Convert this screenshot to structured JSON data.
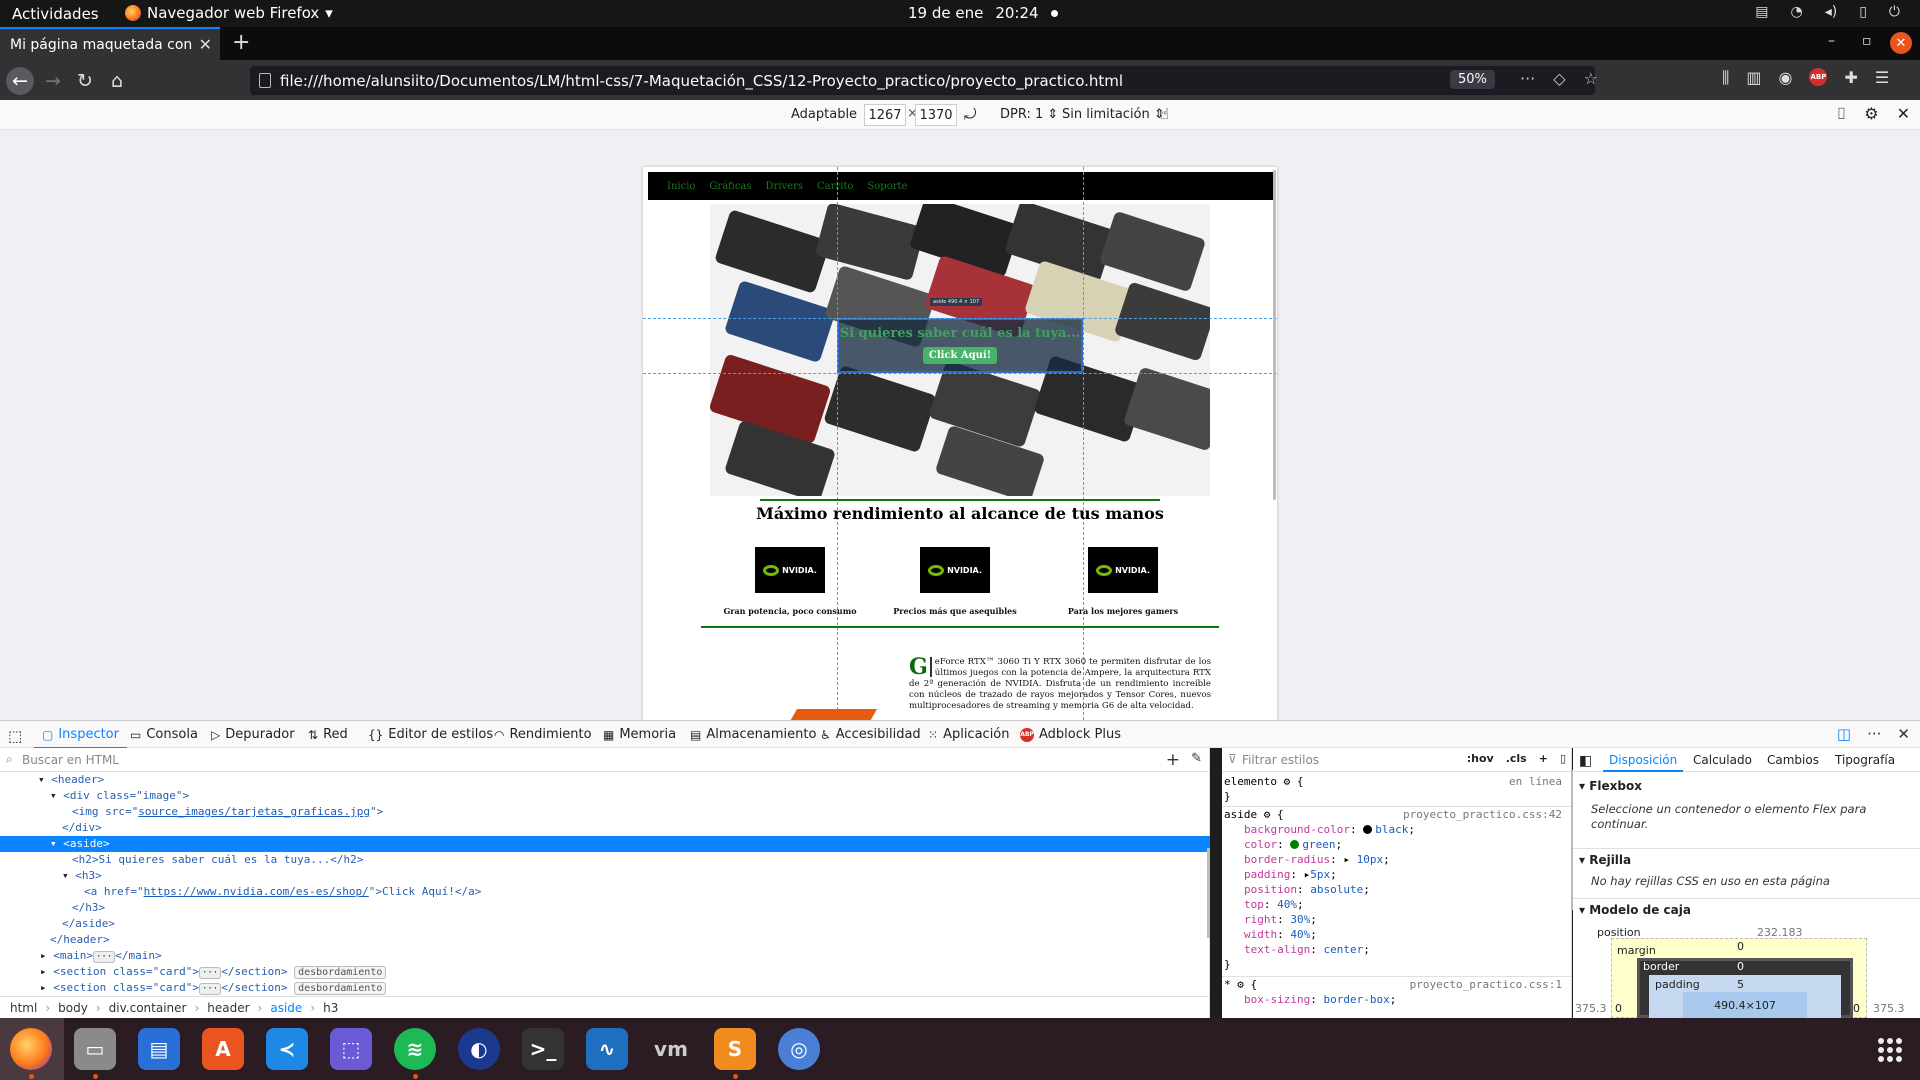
{
  "system": {
    "activities": "Actividades",
    "app_name": "Navegador web Firefox",
    "date": "19 de ene",
    "time": "20:24"
  },
  "browser": {
    "tab_title": "Mi página maquetada con C",
    "url": "file:///home/alunsiito/Documentos/LM/html-css/7-Maquetación_CSS/12-Proyecto_practico/proyecto_practico.html",
    "zoom": "50%"
  },
  "rdm": {
    "device": "Adaptable",
    "width": "1267",
    "height": "1370",
    "times": "×",
    "dpr": "DPR: 1",
    "throttle": "Sin limitación"
  },
  "page": {
    "nav": [
      "Inicio",
      "Gráficas",
      "Drivers",
      "Carrito",
      "Soporte"
    ],
    "aside_h2": "Si quieres saber cuál es la tuya...",
    "aside_button": "Click Aquí!",
    "aside_info": "aside 490.4 × 107",
    "main_title": "Máximo rendimiento al alcance de tus manos",
    "logo_text": "NVIDIA.",
    "cards": [
      "Gran potencia, poco consumo",
      "Precios más que asequibles",
      "Para los mejores gamers"
    ],
    "drop_cap": "G",
    "paragraph": "eForce RTX™ 3060 Ti Y RTX 3060 te permiten disfrutar de los últimos juegos con la potencia de Ampere, la arquitectura RTX de 2ª generación de NVIDIA. Disfruta de un rendimiento increíble con núcleos de trazado de rayos mejorados y Tensor Cores, nuevos multiprocesadores de streaming y memoria G6 de alta velocidad."
  },
  "devtools": {
    "tabs": [
      "Inspector",
      "Consola",
      "Depurador",
      "Red",
      "Editor de estilos",
      "Rendimiento",
      "Memoria",
      "Almacenamiento",
      "Accesibilidad",
      "Aplicación",
      "Adblock Plus"
    ],
    "search_placeholder": "Buscar en HTML",
    "tree": {
      "header_open": "<header>",
      "div_open": "<div class=\"image\">",
      "img_pre": "<img src=\"",
      "img_src": "source_images/tarjetas_graficas.jpg",
      "img_post": "\">",
      "div_close": "</div>",
      "aside_open": "<aside>",
      "h2_line": "<h2>Si quieres saber cuál es la tuya...</h2>",
      "h3_open": "<h3>",
      "a_pre": "<a href=\"",
      "a_href": "https://www.nvidia.com/es-es/shop/",
      "a_post": "\">Click Aquí!</a>",
      "h3_close": "</h3>",
      "aside_close": "</aside>",
      "header_close": "</header>",
      "main_line": "<main>",
      "main_close": "</main>",
      "section_open": "<section class=\"card\">",
      "section_close": "</section>",
      "overflow_badge": "desbordamiento"
    },
    "breadcrumbs": [
      "html",
      "body",
      "div.container",
      "header",
      "aside",
      "h3"
    ],
    "filter_placeholder": "Filtrar estilos",
    "hov": ":hov",
    "cls": ".cls",
    "rules": {
      "element_selector": "elemento",
      "element_source": "en línea",
      "aside_selector": "aside",
      "aside_source": "proyecto_practico.css:42",
      "decls": [
        {
          "prop": "background-color",
          "value": "black"
        },
        {
          "prop": "color",
          "value": "green"
        },
        {
          "prop": "border-radius",
          "value": "10px"
        },
        {
          "prop": "padding",
          "value": "5px"
        },
        {
          "prop": "position",
          "value": "absolute"
        },
        {
          "prop": "top",
          "value": "40%"
        },
        {
          "prop": "right",
          "value": "30%"
        },
        {
          "prop": "width",
          "value": "40%"
        },
        {
          "prop": "text-align",
          "value": "center"
        }
      ],
      "universal_selector": "*",
      "universal_source": "proyecto_practico.css:1",
      "universal_prop": "box-sizing",
      "universal_value": "border-box"
    },
    "layout_tabs": [
      "Disposición",
      "Calculado",
      "Cambios",
      "Tipografía"
    ],
    "flexbox_title": "Flexbox",
    "flexbox_msg": "Seleccione un contenedor o elemento Flex para continuar.",
    "grid_title": "Rejilla",
    "grid_msg": "No hay rejillas CSS en uso en esta página",
    "boxmodel_title": "Modelo de caja",
    "boxmodel": {
      "position_label": "position",
      "position_value": "232.183",
      "margin_label": "margin",
      "margin_value": "0",
      "border_label": "border",
      "border_value": "0",
      "padding_label": "padding",
      "padding_value": "5",
      "content": "490.4×107",
      "left_value": "375.3",
      "side_values": "0",
      "right_value": "375.3"
    }
  },
  "colors": {
    "accent": "#0a84ff",
    "ubuntu_orange": "#e95420",
    "page_green": "#0a7a0a",
    "nvidia_green": "#76b900"
  }
}
